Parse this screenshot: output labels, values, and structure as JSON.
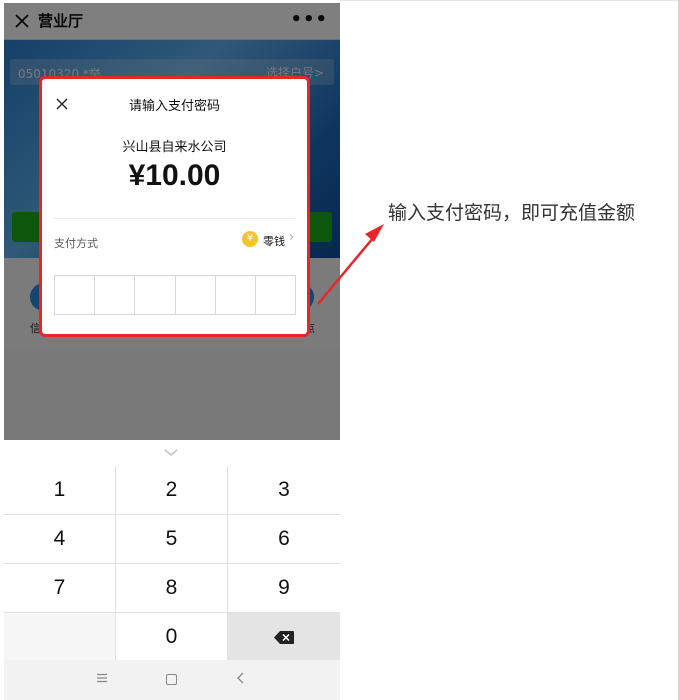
{
  "navbar": {
    "title": "营业厅",
    "more_icon": "ellipsis-icon",
    "close_icon": "close-icon"
  },
  "account": {
    "number": "05010320 *举",
    "switch_label": "选择户号>"
  },
  "icon_row": {
    "left_label": "信",
    "right_label": "点"
  },
  "dialog": {
    "title": "请输入支付密码",
    "payee": "兴山县自来水公司",
    "amount": "¥10.00",
    "method_label": "支付方式",
    "method_value": "零钱",
    "method_arrow": "›",
    "coin_symbol": "¥",
    "password_cells": 6,
    "highlight_color": "#e8262a"
  },
  "keypad": {
    "keys": [
      "1",
      "2",
      "3",
      "4",
      "5",
      "6",
      "7",
      "8",
      "9",
      "",
      "0",
      "⌫"
    ]
  },
  "annotation": {
    "text": "输入支付密码，即可充值金额"
  }
}
